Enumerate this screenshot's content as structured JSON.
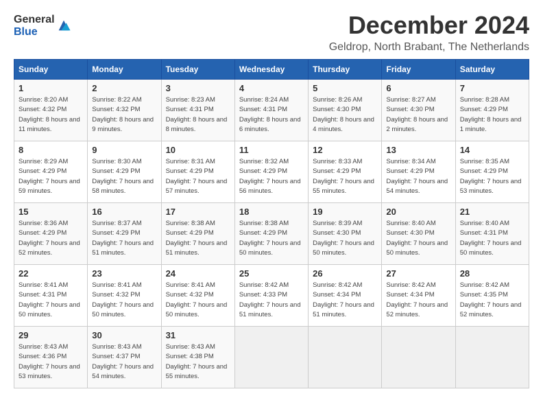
{
  "logo": {
    "general": "General",
    "blue": "Blue"
  },
  "header": {
    "month": "December 2024",
    "location": "Geldrop, North Brabant, The Netherlands"
  },
  "days_of_week": [
    "Sunday",
    "Monday",
    "Tuesday",
    "Wednesday",
    "Thursday",
    "Friday",
    "Saturday"
  ],
  "weeks": [
    [
      {
        "day": "1",
        "sunrise": "8:20 AM",
        "sunset": "4:32 PM",
        "daylight": "8 hours and 11 minutes."
      },
      {
        "day": "2",
        "sunrise": "8:22 AM",
        "sunset": "4:32 PM",
        "daylight": "8 hours and 9 minutes."
      },
      {
        "day": "3",
        "sunrise": "8:23 AM",
        "sunset": "4:31 PM",
        "daylight": "8 hours and 8 minutes."
      },
      {
        "day": "4",
        "sunrise": "8:24 AM",
        "sunset": "4:31 PM",
        "daylight": "8 hours and 6 minutes."
      },
      {
        "day": "5",
        "sunrise": "8:26 AM",
        "sunset": "4:30 PM",
        "daylight": "8 hours and 4 minutes."
      },
      {
        "day": "6",
        "sunrise": "8:27 AM",
        "sunset": "4:30 PM",
        "daylight": "8 hours and 2 minutes."
      },
      {
        "day": "7",
        "sunrise": "8:28 AM",
        "sunset": "4:29 PM",
        "daylight": "8 hours and 1 minute."
      }
    ],
    [
      {
        "day": "8",
        "sunrise": "8:29 AM",
        "sunset": "4:29 PM",
        "daylight": "7 hours and 59 minutes."
      },
      {
        "day": "9",
        "sunrise": "8:30 AM",
        "sunset": "4:29 PM",
        "daylight": "7 hours and 58 minutes."
      },
      {
        "day": "10",
        "sunrise": "8:31 AM",
        "sunset": "4:29 PM",
        "daylight": "7 hours and 57 minutes."
      },
      {
        "day": "11",
        "sunrise": "8:32 AM",
        "sunset": "4:29 PM",
        "daylight": "7 hours and 56 minutes."
      },
      {
        "day": "12",
        "sunrise": "8:33 AM",
        "sunset": "4:29 PM",
        "daylight": "7 hours and 55 minutes."
      },
      {
        "day": "13",
        "sunrise": "8:34 AM",
        "sunset": "4:29 PM",
        "daylight": "7 hours and 54 minutes."
      },
      {
        "day": "14",
        "sunrise": "8:35 AM",
        "sunset": "4:29 PM",
        "daylight": "7 hours and 53 minutes."
      }
    ],
    [
      {
        "day": "15",
        "sunrise": "8:36 AM",
        "sunset": "4:29 PM",
        "daylight": "7 hours and 52 minutes."
      },
      {
        "day": "16",
        "sunrise": "8:37 AM",
        "sunset": "4:29 PM",
        "daylight": "7 hours and 51 minutes."
      },
      {
        "day": "17",
        "sunrise": "8:38 AM",
        "sunset": "4:29 PM",
        "daylight": "7 hours and 51 minutes."
      },
      {
        "day": "18",
        "sunrise": "8:38 AM",
        "sunset": "4:29 PM",
        "daylight": "7 hours and 50 minutes."
      },
      {
        "day": "19",
        "sunrise": "8:39 AM",
        "sunset": "4:30 PM",
        "daylight": "7 hours and 50 minutes."
      },
      {
        "day": "20",
        "sunrise": "8:40 AM",
        "sunset": "4:30 PM",
        "daylight": "7 hours and 50 minutes."
      },
      {
        "day": "21",
        "sunrise": "8:40 AM",
        "sunset": "4:31 PM",
        "daylight": "7 hours and 50 minutes."
      }
    ],
    [
      {
        "day": "22",
        "sunrise": "8:41 AM",
        "sunset": "4:31 PM",
        "daylight": "7 hours and 50 minutes."
      },
      {
        "day": "23",
        "sunrise": "8:41 AM",
        "sunset": "4:32 PM",
        "daylight": "7 hours and 50 minutes."
      },
      {
        "day": "24",
        "sunrise": "8:41 AM",
        "sunset": "4:32 PM",
        "daylight": "7 hours and 50 minutes."
      },
      {
        "day": "25",
        "sunrise": "8:42 AM",
        "sunset": "4:33 PM",
        "daylight": "7 hours and 51 minutes."
      },
      {
        "day": "26",
        "sunrise": "8:42 AM",
        "sunset": "4:34 PM",
        "daylight": "7 hours and 51 minutes."
      },
      {
        "day": "27",
        "sunrise": "8:42 AM",
        "sunset": "4:34 PM",
        "daylight": "7 hours and 52 minutes."
      },
      {
        "day": "28",
        "sunrise": "8:42 AM",
        "sunset": "4:35 PM",
        "daylight": "7 hours and 52 minutes."
      }
    ],
    [
      {
        "day": "29",
        "sunrise": "8:43 AM",
        "sunset": "4:36 PM",
        "daylight": "7 hours and 53 minutes."
      },
      {
        "day": "30",
        "sunrise": "8:43 AM",
        "sunset": "4:37 PM",
        "daylight": "7 hours and 54 minutes."
      },
      {
        "day": "31",
        "sunrise": "8:43 AM",
        "sunset": "4:38 PM",
        "daylight": "7 hours and 55 minutes."
      },
      null,
      null,
      null,
      null
    ]
  ]
}
